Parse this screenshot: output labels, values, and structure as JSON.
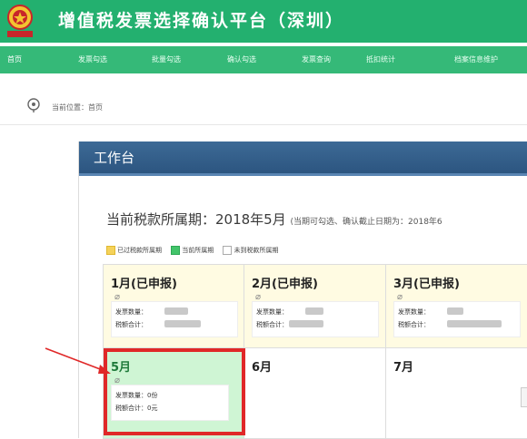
{
  "header": {
    "title": "增值税发票选择确认平台（深圳）",
    "logo_text": "中国税务"
  },
  "nav": {
    "items": [
      {
        "label": "首页",
        "active": true
      },
      {
        "label": "发票勾选",
        "active": false
      },
      {
        "label": "批量勾选",
        "active": false
      },
      {
        "label": "确认勾选",
        "active": false
      },
      {
        "label": "发票查询",
        "active": false
      },
      {
        "label": "抵扣统计",
        "active": false
      },
      {
        "label": "档案信息维护",
        "active": false
      }
    ]
  },
  "breadcrumb": {
    "text": "当前位置：首页"
  },
  "panel": {
    "title": "工作台",
    "period_label": "当前税款所属期：2018年5月",
    "period_note": "(当期可勾选、确认截止日期为：2018年6"
  },
  "legend": [
    {
      "label": "已过税款所属期",
      "color": "#f5d25a"
    },
    {
      "label": "当前所属期",
      "color": "#42c46a"
    },
    {
      "label": "未到税款所属期",
      "color": "#ffffff"
    }
  ],
  "months": [
    {
      "month": "1月(已申报)",
      "status": "declared",
      "count_label": "发票数量：",
      "tax_label": "税额合计："
    },
    {
      "month": "2月(已申报)",
      "status": "declared",
      "count_label": "发票数量：",
      "tax_label": "税额合计："
    },
    {
      "month": "3月(已申报)",
      "status": "declared",
      "count_label": "发票数量：",
      "tax_label": "税额合计："
    },
    {
      "month": "5月",
      "status": "current",
      "count_label": "发票数量：0份",
      "tax_label": "税额合计：0元"
    },
    {
      "month": "6月",
      "status": "future"
    },
    {
      "month": "7月",
      "status": "future"
    }
  ],
  "colors": {
    "header_green": "#23b06f",
    "nav_green": "#35b978",
    "panel_blue": "#2c5580",
    "highlight_red": "#e02828"
  }
}
